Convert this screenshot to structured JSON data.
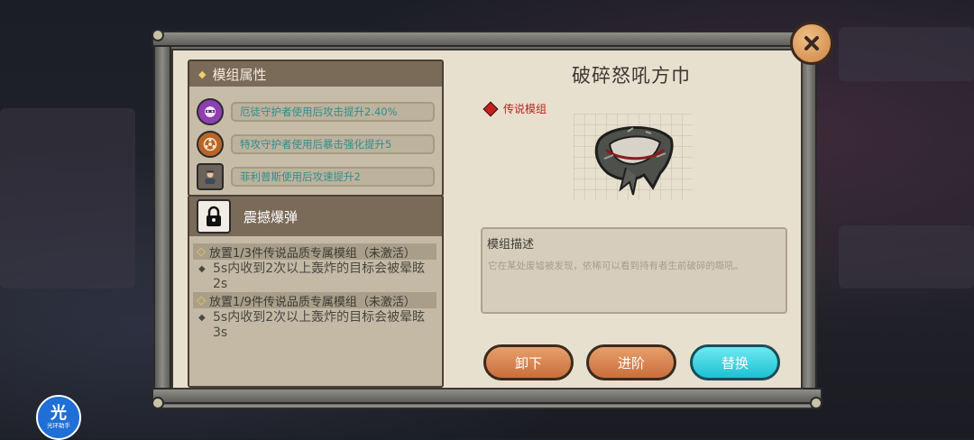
{
  "attributes": {
    "title": "模组属性",
    "items": [
      {
        "text": "厄徒守护者使用后攻击提升2.40%",
        "icon": "masked-hero-icon",
        "color": "#8e3fb3"
      },
      {
        "text": "特攻守护者使用后暴击强化提升5",
        "icon": "biohazard-icon",
        "color": "#b7652a"
      },
      {
        "text": "菲利普斯使用后攻速提升2",
        "icon": "portrait-icon",
        "color": "#6b6259"
      }
    ]
  },
  "skill": {
    "title": "震撼爆弹",
    "icon": "lock-icon",
    "tiers": [
      {
        "condition": "放置1/3件传说品质专属模组（未激活）",
        "effect": "5s内收到2次以上轰炸的目标会被晕眩2s"
      },
      {
        "condition": "放置1/9件传说品质专属模组（未激活）",
        "effect": "5s内收到2次以上轰炸的目标会被晕眩3s"
      }
    ]
  },
  "item": {
    "name": "破碎怒吼方巾",
    "rarity": "传说模组",
    "rarity_color": "#c2201c",
    "description_title": "模组描述",
    "description": "它在某处废墟被发现，依稀可以看到持有者生前破碎的嘶吼。"
  },
  "buttons": {
    "unequip": "卸下",
    "advance": "进阶",
    "replace": "替换"
  },
  "watermark": {
    "big": "光",
    "small": "光环助手"
  }
}
